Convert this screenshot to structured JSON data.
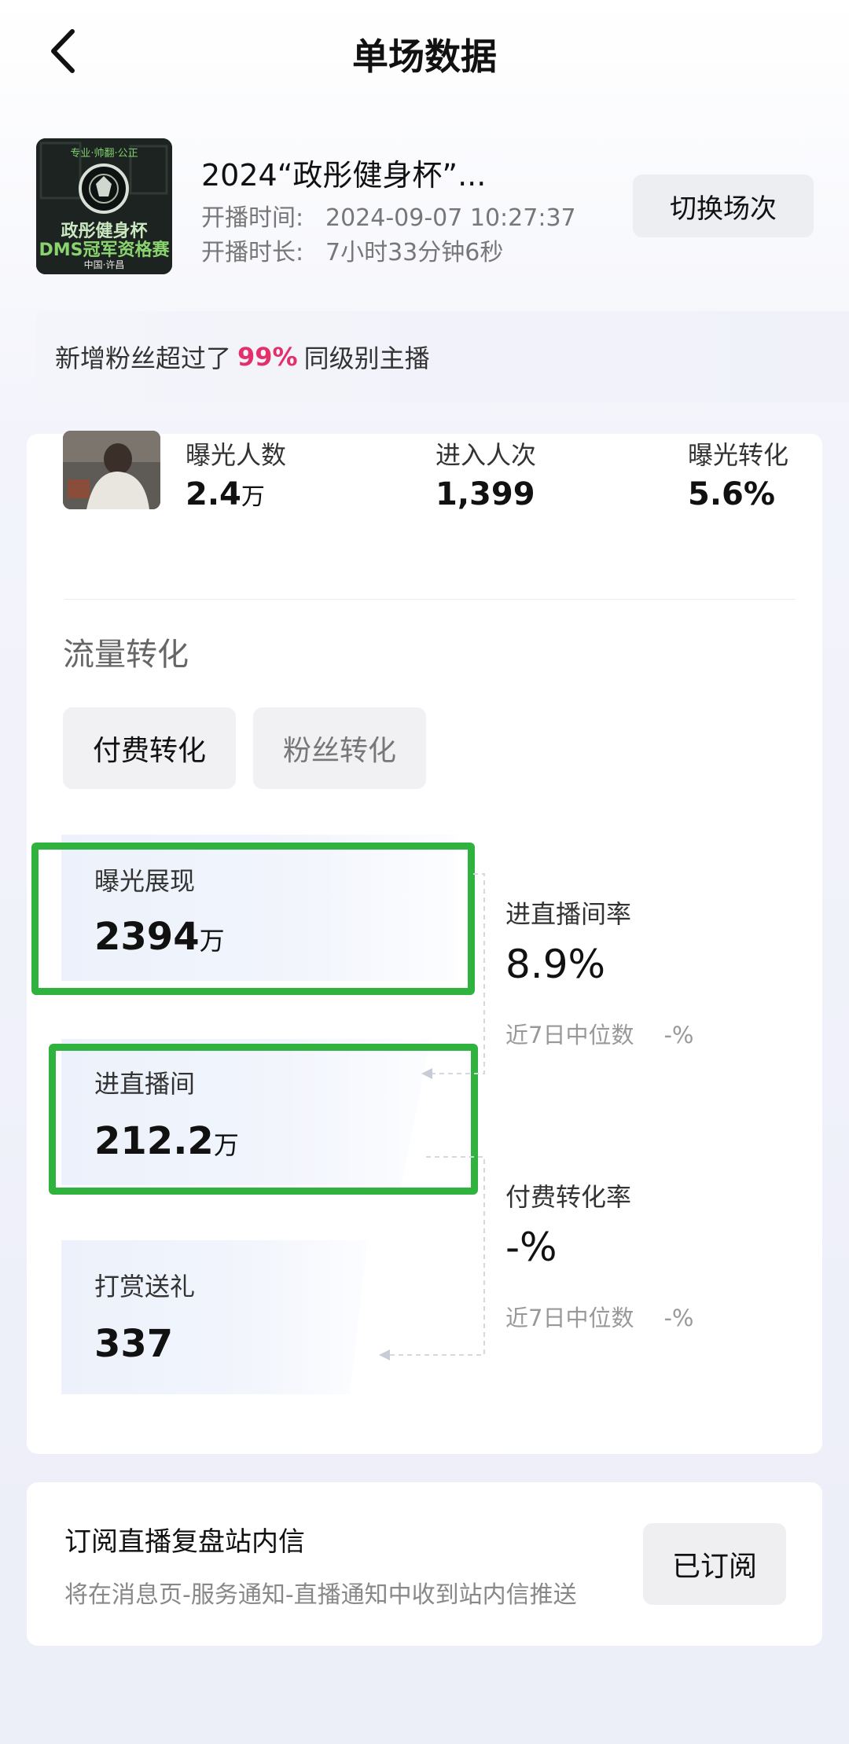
{
  "header": {
    "title": "单场数据"
  },
  "session": {
    "title": "2024“政彤健身杯”...",
    "start_time_label": "开播时间:",
    "start_time": "2024-09-07 10:27:37",
    "duration_label": "开播时长:",
    "duration": "7小时33分钟6秒",
    "switch_button": "切换场次",
    "cover": {
      "top_text": "专业·帅翻·公正",
      "name_line1": "政彤健身杯",
      "name_line2": "DMS冠军资格赛",
      "bottom_text": "中国·许昌"
    }
  },
  "fans_banner": {
    "prefix": "新增粉丝超过了",
    "percent": "99%",
    "suffix": "同级别主播",
    "accent_color": "#e4306a"
  },
  "stats": [
    {
      "label": "曝光人数",
      "value": "2.4",
      "unit": "万"
    },
    {
      "label": "进入人次",
      "value": "1,399",
      "unit": ""
    },
    {
      "label": "曝光转化",
      "value": "5.6%",
      "unit": ""
    }
  ],
  "traffic": {
    "section_title": "流量转化",
    "tabs": [
      {
        "label": "付费转化",
        "selected": true
      },
      {
        "label": "粉丝转化",
        "selected": false
      }
    ],
    "funnel": [
      {
        "label": "曝光展现",
        "value": "2394",
        "unit": "万",
        "highlighted": true
      },
      {
        "label": "进直播间",
        "value": "212.2",
        "unit": "万",
        "highlighted": true
      },
      {
        "label": "打赏送礼",
        "value": "337",
        "unit": "",
        "highlighted": false
      }
    ],
    "rates": [
      {
        "label": "进直播间率",
        "value": "8.9%",
        "median_label": "近7日中位数",
        "median_value": "-%"
      },
      {
        "label": "付费转化率",
        "value": "-%",
        "median_label": "近7日中位数",
        "median_value": "-%"
      }
    ],
    "highlight_color": "#2fb33e"
  },
  "subscribe": {
    "title": "订阅直播复盘站内信",
    "description": "将在消息页-服务通知-直播通知中收到站内信推送",
    "button": "已订阅"
  }
}
